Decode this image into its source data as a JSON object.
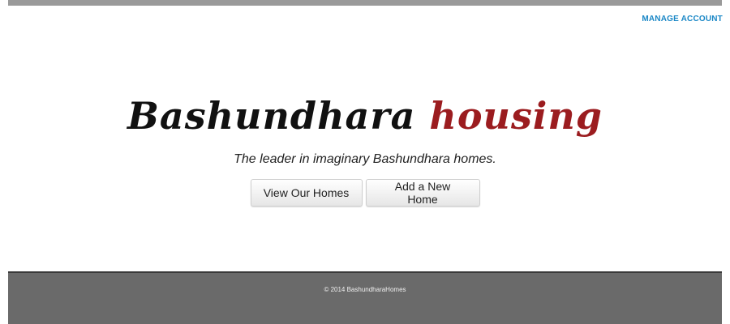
{
  "header": {
    "manage_account_label": "MANAGE ACCOUNT"
  },
  "hero": {
    "brand_main": "Bashundhara",
    "brand_accent": "housing",
    "tagline": "The leader in imaginary Bashundhara homes."
  },
  "actions": {
    "view_homes_label": "View Our Homes",
    "add_home_label": "Add a New Home"
  },
  "footer": {
    "copyright": "© 2014 BashundharaHomes"
  },
  "colors": {
    "accent_link": "#1a87c6",
    "brand_accent": "#9b1c1f",
    "footer_bg": "#6a6a6a",
    "top_bar": "#9a9a9a"
  }
}
